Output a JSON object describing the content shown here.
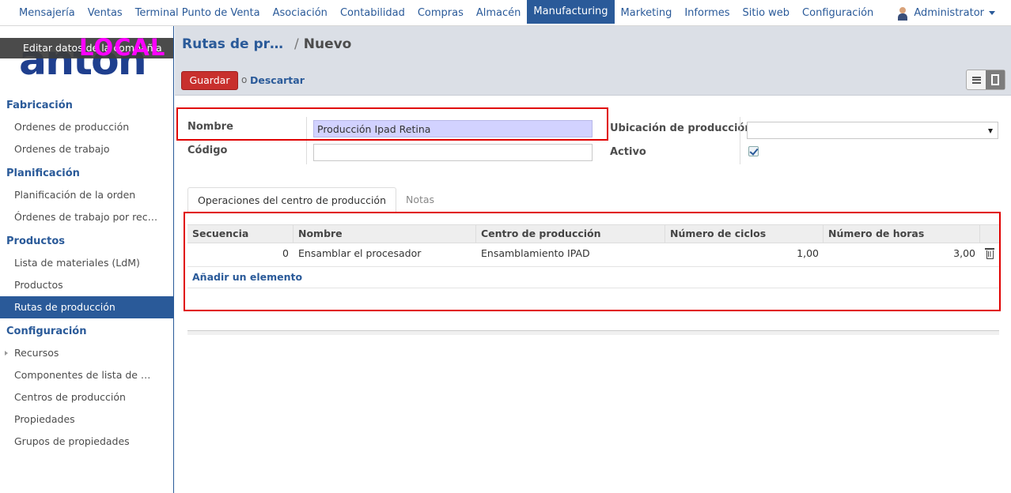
{
  "topnav": {
    "items": [
      "Mensajería",
      "Ventas",
      "Terminal Punto de Venta",
      "Asociación",
      "Contabilidad",
      "Compras",
      "Almacén",
      "Manufacturing",
      "Marketing",
      "Informes",
      "Sitio web",
      "Configuración"
    ],
    "active": "Manufacturing",
    "user": "Administrator"
  },
  "sidebar": {
    "logo_text": "anton",
    "edit_company": "Editar datos de la compañía",
    "local_badge": "LOCAL",
    "sections": [
      {
        "title": "Fabricación",
        "items": [
          "Ordenes de producción",
          "Ordenes de trabajo"
        ]
      },
      {
        "title": "Planificación",
        "items": [
          "Planificación de la orden",
          "Órdenes de trabajo por rec…"
        ]
      },
      {
        "title": "Productos",
        "items": [
          "Lista de materiales (LdM)",
          "Productos",
          "Rutas de producción"
        ]
      },
      {
        "title": "Configuración",
        "items": [
          "Recursos",
          "Componentes de lista de …",
          "Centros de producción",
          "Propiedades",
          "Grupos de propiedades"
        ]
      }
    ],
    "active_item": "Rutas de producción"
  },
  "header": {
    "breadcrumb_parent": "Rutas de pr…",
    "breadcrumb_sep": "/",
    "breadcrumb_current": "Nuevo",
    "save_label": "Guardar",
    "or_label": "o",
    "discard_label": "Descartar"
  },
  "form": {
    "name_label": "Nombre",
    "name_value": "Producción Ipad Retina",
    "code_label": "Código",
    "code_value": "",
    "location_label": "Ubicación de producción",
    "location_value": "",
    "active_label": "Activo",
    "active_checked": true
  },
  "tabs": [
    "Operaciones del centro de producción",
    "Notas"
  ],
  "grid": {
    "columns": [
      "Secuencia",
      "Nombre",
      "Centro de producción",
      "Número de ciclos",
      "Número de horas"
    ],
    "rows": [
      {
        "secuencia": "0",
        "nombre": "Ensamblar el procesador",
        "centro": "Ensamblamiento IPAD",
        "ciclos": "1,00",
        "horas": "3,00"
      }
    ],
    "add_label": "Añadir un elemento"
  },
  "colors": {
    "accent": "#2a5a99",
    "save_button": "#c8302d",
    "required_field": "#d2d2ff",
    "annotation_box": "#e00000",
    "local_badge": "#ff00ff"
  }
}
